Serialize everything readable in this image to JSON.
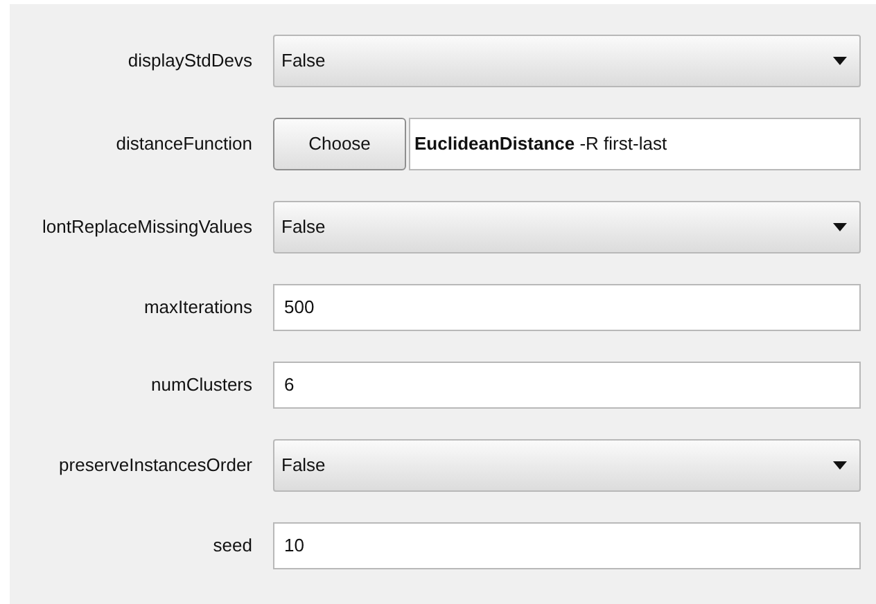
{
  "properties": [
    {
      "label": "displayStdDevs",
      "kind": "dropdown",
      "value": "False"
    },
    {
      "label": "distanceFunction",
      "kind": "chooser",
      "button": "Choose",
      "value": "**EuclideanDistance** -R first-last"
    },
    {
      "label": "lontReplaceMissingValues",
      "kind": "dropdown",
      "value": "False"
    },
    {
      "label": "maxIterations",
      "kind": "text",
      "value": "500"
    },
    {
      "label": "numClusters",
      "kind": "text",
      "value": "6"
    },
    {
      "label": "preserveInstancesOrder",
      "kind": "dropdown",
      "value": "False"
    },
    {
      "label": "seed",
      "kind": "text",
      "value": "10"
    }
  ]
}
